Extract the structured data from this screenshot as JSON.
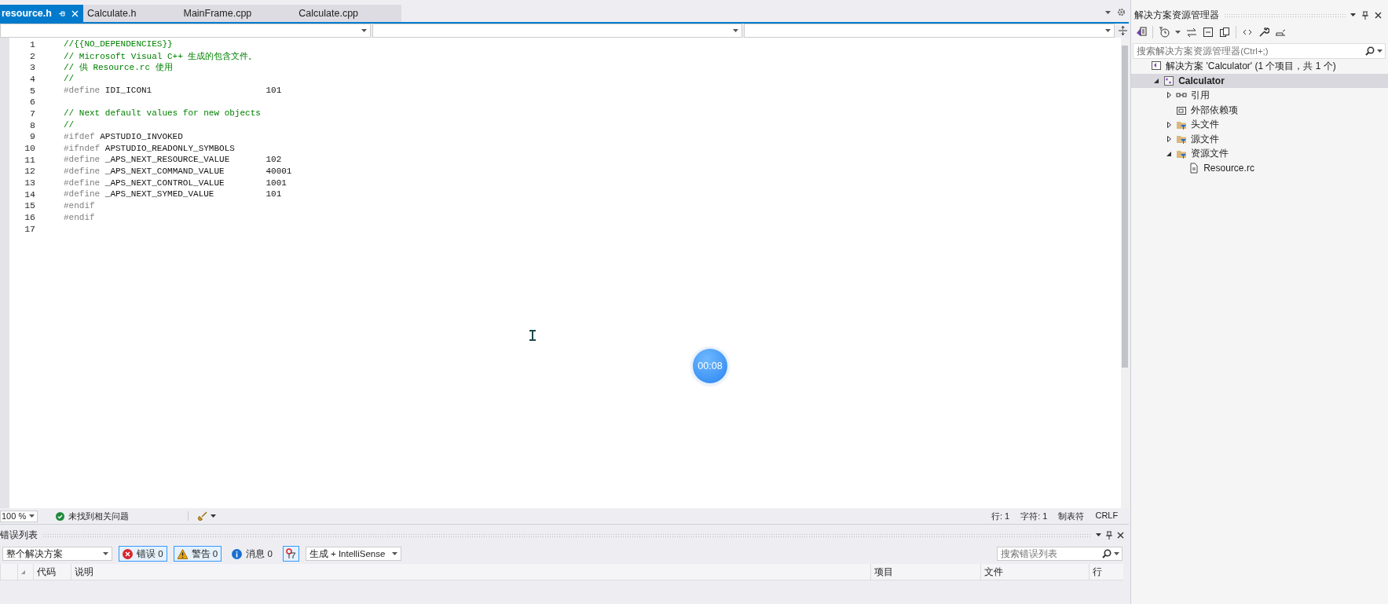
{
  "tabs": [
    {
      "label": "resource.h",
      "selected": true
    },
    {
      "label": "Calculate.h",
      "selected": false
    },
    {
      "label": "MainFrame.cpp",
      "selected": false
    },
    {
      "label": "Calculate.cpp",
      "selected": false
    }
  ],
  "editor": {
    "lines": [
      {
        "number": "1",
        "tokens": [
          {
            "kind": "comment",
            "text": "//{{NO_DEPENDENCIES}}"
          }
        ]
      },
      {
        "number": "2",
        "tokens": [
          {
            "kind": "comment",
            "text": "// Microsoft Visual C++ 生成的包含文件。"
          }
        ]
      },
      {
        "number": "3",
        "tokens": [
          {
            "kind": "comment",
            "text": "// 供 Resource.rc 使用"
          }
        ]
      },
      {
        "number": "4",
        "tokens": [
          {
            "kind": "comment",
            "text": "//"
          }
        ]
      },
      {
        "number": "5",
        "tokens": [
          {
            "kind": "directive",
            "text": "#define"
          },
          {
            "kind": "macro",
            "text": "IDI_ICON1"
          },
          {
            "kind": "value",
            "text": "101"
          }
        ]
      },
      {
        "number": "6"
      },
      {
        "number": "7",
        "tokens": [
          {
            "kind": "comment",
            "text": "// Next default values for new objects"
          }
        ]
      },
      {
        "number": "8",
        "tokens": [
          {
            "kind": "comment",
            "text": "//"
          }
        ]
      },
      {
        "number": "9",
        "tokens": [
          {
            "kind": "directive",
            "text": "#ifdef"
          },
          {
            "kind": "macro",
            "text": "APSTUDIO_INVOKED"
          }
        ]
      },
      {
        "number": "10",
        "tokens": [
          {
            "kind": "directive",
            "text": "#ifndef"
          },
          {
            "kind": "macro",
            "text": "APSTUDIO_READONLY_SYMBOLS"
          }
        ]
      },
      {
        "number": "11",
        "tokens": [
          {
            "kind": "directive",
            "text": "#define"
          },
          {
            "kind": "macro",
            "text": "_APS_NEXT_RESOURCE_VALUE"
          },
          {
            "kind": "value",
            "text": "102"
          }
        ]
      },
      {
        "number": "12",
        "tokens": [
          {
            "kind": "directive",
            "text": "#define"
          },
          {
            "kind": "macro",
            "text": "_APS_NEXT_COMMAND_VALUE"
          },
          {
            "kind": "value",
            "text": "40001"
          }
        ]
      },
      {
        "number": "13",
        "tokens": [
          {
            "kind": "directive",
            "text": "#define"
          },
          {
            "kind": "macro",
            "text": "_APS_NEXT_CONTROL_VALUE"
          },
          {
            "kind": "value",
            "text": "1001"
          }
        ]
      },
      {
        "number": "14",
        "tokens": [
          {
            "kind": "directive",
            "text": "#define"
          },
          {
            "kind": "macro",
            "text": "_APS_NEXT_SYMED_VALUE"
          },
          {
            "kind": "value",
            "text": "101"
          }
        ]
      },
      {
        "number": "15",
        "tokens": [
          {
            "kind": "directive",
            "text": "#endif"
          }
        ]
      },
      {
        "number": "16",
        "tokens": [
          {
            "kind": "directive",
            "text": "#endif"
          }
        ]
      },
      {
        "number": "17"
      }
    ]
  },
  "recording_timer": "00:08",
  "status_bar": {
    "zoom": "100 %",
    "issues": "未找到相关问题",
    "position": [
      "行: 1",
      "字符: 1",
      "制表符",
      "CRLF"
    ]
  },
  "error_list": {
    "title": "错误列表",
    "scope": "整个解决方案",
    "filters": [
      {
        "kind": "error",
        "label": "错误 0",
        "on": true
      },
      {
        "kind": "warning",
        "label": "警告 0",
        "on": true
      },
      {
        "kind": "message",
        "label": "消息 0",
        "on": false
      }
    ],
    "source": "生成 + IntelliSense",
    "search": {
      "placeholder": "搜索错误列表"
    },
    "columns": [
      "代码",
      "说明",
      "项目",
      "文件",
      "行"
    ]
  },
  "solution_explorer": {
    "title": "解决方案资源管理器",
    "search": {
      "placeholder": "搜索解决方案资源管理器(Ctrl+;)"
    },
    "tree": [
      {
        "label": "解决方案 'Calculator' (1 个项目，共 1 个)",
        "kind": "solution",
        "selected": false,
        "children": [
          {
            "label": "Calculator",
            "kind": "project",
            "selected": true,
            "expanded": true,
            "children": [
              {
                "label": "引用",
                "kind": "references",
                "selected": false,
                "expanded": false
              },
              {
                "label": "外部依赖项",
                "kind": "external",
                "selected": false
              },
              {
                "label": "头文件",
                "kind": "filter",
                "selected": false,
                "expanded": false
              },
              {
                "label": "源文件",
                "kind": "filter",
                "selected": false,
                "expanded": false
              },
              {
                "label": "资源文件",
                "kind": "filter",
                "selected": false,
                "expanded": true,
                "children": [
                  {
                    "label": "Resource.rc",
                    "kind": "file",
                    "selected": false
                  }
                ]
              }
            ]
          }
        ]
      }
    ]
  }
}
